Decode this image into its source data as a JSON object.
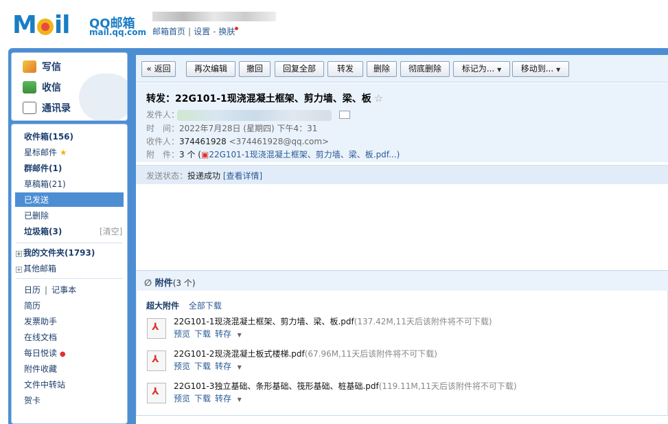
{
  "header": {
    "logo_text": "MOil",
    "logo_qq": "QQ邮箱",
    "logo_domain": "mail.qq.com",
    "links": [
      "邮箱首页",
      "设置",
      "换肤"
    ],
    "link_seps": [
      "|",
      "-"
    ]
  },
  "sidebar": {
    "quick": [
      {
        "label": "写信",
        "icon": "pencil-icon"
      },
      {
        "label": "收信",
        "icon": "inbox-download-icon"
      },
      {
        "label": "通讯录",
        "icon": "contacts-card-icon"
      }
    ],
    "folders": {
      "inbox": "收件箱(156)",
      "starred": "星标邮件",
      "group": "群邮件(1)",
      "drafts": "草稿箱(21)",
      "sent": "已发送",
      "deleted": "已删除",
      "spam": "垃圾箱(3)",
      "spam_clear": "[清空]",
      "my_folders": "我的文件夹(1793)",
      "other_mailbox": "其他邮箱",
      "calendar": "日历",
      "calendar_sep": "|",
      "notebook": "记事本",
      "resume": "简历",
      "invoice": "发票助手",
      "docs": "在线文档",
      "daily": "每日悦读",
      "att_fav": "附件收藏",
      "transfer": "文件中转站",
      "card": "贺卡"
    }
  },
  "toolbar": {
    "back": "« 返回",
    "reedit": "再次编辑",
    "recall": "撤回",
    "reply_all": "回复全部",
    "forward": "转发",
    "delete": "删除",
    "perm_delete": "彻底删除",
    "mark_as": "标记为...",
    "move_to": "移动到..."
  },
  "mail": {
    "subject": "转发：22G101-1现浇混凝土框架、剪力墙、梁、板",
    "sender_label": "发件人：",
    "time_label": "时　间：",
    "time_value": "2022年7月28日 (星期四) 下午4：31",
    "to_label": "收件人：",
    "to_name": "374461928",
    "to_addr": "<374461928@qq.com>",
    "att_label": "附　件：",
    "att_count": "3 个 (",
    "att_first": "22G101-1现浇混凝土框架、剪力墙、梁、板.pdf...)",
    "status_label": "发送状态：",
    "status_value": "投递成功",
    "status_link": "[查看详情]"
  },
  "attachments": {
    "title": "附件",
    "count": "(3 个)",
    "tab_large": "超大附件",
    "tab_download_all": "全部下载",
    "items": [
      {
        "name": "22G101-1现浇混凝土框架、剪力墙、梁、板.pdf",
        "meta": "(137.42M,11天后该附件将不可下载)"
      },
      {
        "name": "22G101-2现浇混凝土板式楼梯.pdf",
        "meta": "(67.96M,11天后该附件将不可下载)"
      },
      {
        "name": "22G101-3独立基础、条形基础、筏形基础、桩基础.pdf",
        "meta": "(119.11M,11天后该附件将不可下载)"
      }
    ],
    "ops": {
      "preview": "预览",
      "download": "下载",
      "save": "转存"
    }
  }
}
